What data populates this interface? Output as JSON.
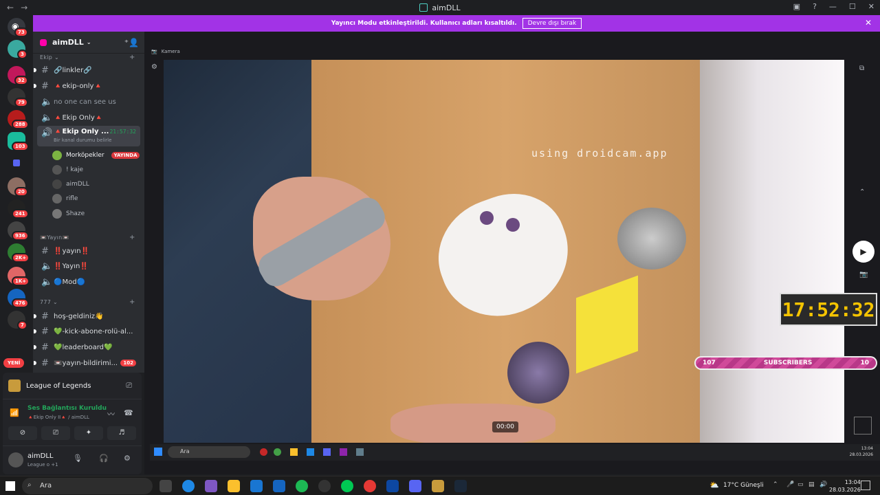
{
  "window": {
    "title": "aimDLL",
    "back": "←",
    "forward": "→"
  },
  "banner": {
    "text": "Yayıncı Modu etkinleştirildi. Kullanıcı adları kısaltıldı.",
    "button": "Devre dışı bırak"
  },
  "rail_badges": [
    "73",
    "3",
    "32",
    "79",
    "288",
    "103",
    "20",
    "241",
    "936",
    "2K+",
    "1K+",
    "476",
    "7"
  ],
  "new_pill": "YENİ",
  "guild": {
    "name": "aimDLL"
  },
  "categories": {
    "ekip": "Ekip",
    "yayin": "Yayın",
    "777": "777"
  },
  "channels": [
    {
      "name": "🔗linkler🔗",
      "type": "text"
    },
    {
      "name": "🔺ekip-only🔺",
      "type": "text"
    },
    {
      "name": "no one can see us",
      "type": "voice"
    },
    {
      "name": "🔺Ekip Only🔺",
      "type": "voice"
    },
    {
      "name": "🔺Ekip Only ...",
      "type": "voice",
      "time": "21:57:32",
      "status": "Bir kanal durumu belirle"
    }
  ],
  "voice_users": [
    {
      "name": "Morköpekler",
      "live": "YAYINDA"
    },
    {
      "name": "! kaje"
    },
    {
      "name": "aimDLL"
    },
    {
      "name": "rifle"
    },
    {
      "name": "Shaze"
    }
  ],
  "yayin_channels": [
    "‼️yayın‼️",
    "‼️Yayın‼️",
    "🔵Mod🔵"
  ],
  "c777_channels": [
    {
      "name": "hoş-geldiniz👋"
    },
    {
      "name": "💚-kick-abone-rolü-al..."
    },
    {
      "name": "💚leaderboard💚"
    },
    {
      "name": "📼yayın-bildirimi...",
      "count": "102"
    }
  ],
  "activity": {
    "game": "League of Legends"
  },
  "voice_status": {
    "title": "Ses Bağlantısı Kuruldu",
    "detail": "🔺Ekip Only II🔺 / aimDLL"
  },
  "user": {
    "name": "aimDLL",
    "status": "League o +1"
  },
  "video": {
    "window_label": "Kamera",
    "watermark": "using droidcam.app",
    "timestamp": "00:00"
  },
  "overlay": {
    "clock": "17:52:32",
    "subs_left": "107",
    "subs_label": "SUBSCRIBERS",
    "subs_right": "10"
  },
  "inner_taskbar": {
    "search": "Ara",
    "time": "13:04",
    "date": "28.03.2026"
  },
  "taskbar": {
    "search": "Ara",
    "weather": "17°C  Güneşli",
    "time": "13:04",
    "date": "28.03.2026"
  },
  "colors": {
    "accent": "#a233e6",
    "badge": "#f23f43",
    "online": "#23a55a",
    "clock": "#f5c400"
  }
}
